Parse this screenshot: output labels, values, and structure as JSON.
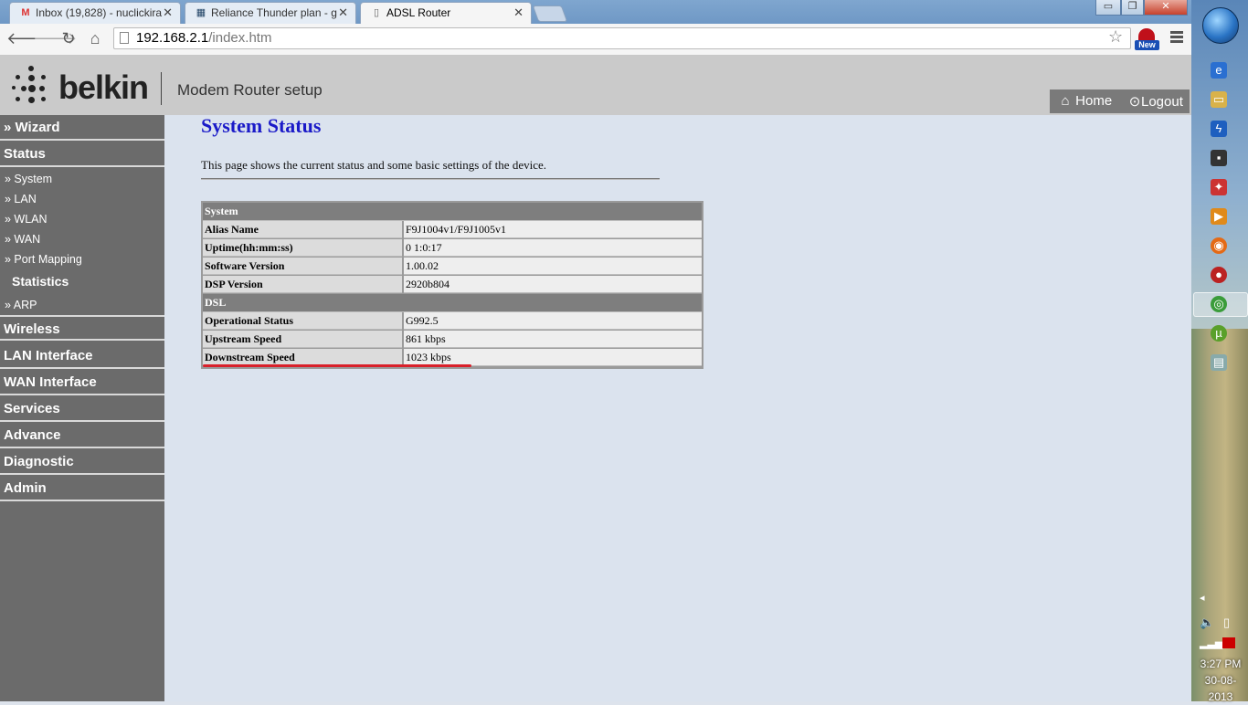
{
  "browser": {
    "tabs": [
      {
        "title": "Inbox (19,828) - nuclickira",
        "icon": "M",
        "active": false
      },
      {
        "title": "Reliance Thunder plan - g",
        "icon": "▦",
        "active": false
      },
      {
        "title": "ADSL Router",
        "icon": "▯",
        "active": true
      }
    ],
    "url_domain": "192.168.2.1",
    "url_path": "/index.htm",
    "window_controls": {
      "minimize": "▭",
      "maximize": "❐",
      "close": "✕"
    },
    "extension_badge": "New"
  },
  "header": {
    "brand": "belkin",
    "subtitle": "Modem Router setup",
    "home_label": "Home",
    "logout_label": "Logout"
  },
  "sidebar": {
    "wizard": "» Wizard",
    "status": "Status",
    "status_items": [
      "» System",
      "» LAN",
      "» WLAN",
      "» WAN",
      "» Port Mapping"
    ],
    "statistics": "Statistics",
    "statistics_items": [
      "» ARP"
    ],
    "main_items": [
      "Wireless",
      "LAN Interface",
      "WAN Interface",
      "Services",
      "Advance",
      "Diagnostic",
      "Admin"
    ]
  },
  "main": {
    "title": "System Status",
    "description": "This page shows the current status and some basic settings of the device.",
    "table": {
      "system_header": "System",
      "system_rows": [
        {
          "label": "Alias Name",
          "value": "F9J1004v1/F9J1005v1"
        },
        {
          "label": "Uptime(hh:mm:ss)",
          "value": "0 1:0:17"
        },
        {
          "label": "Software Version",
          "value": "1.00.02"
        },
        {
          "label": "DSP Version",
          "value": "2920b804"
        }
      ],
      "dsl_header": "DSL",
      "dsl_rows": [
        {
          "label": "Operational Status",
          "value": "G992.5"
        },
        {
          "label": "Upstream Speed",
          "value": "861 kbps"
        },
        {
          "label": "Downstream Speed",
          "value": "1023 kbps"
        }
      ]
    }
  },
  "taskbar": {
    "time": "3:27 PM",
    "date": "30-08-2013"
  }
}
